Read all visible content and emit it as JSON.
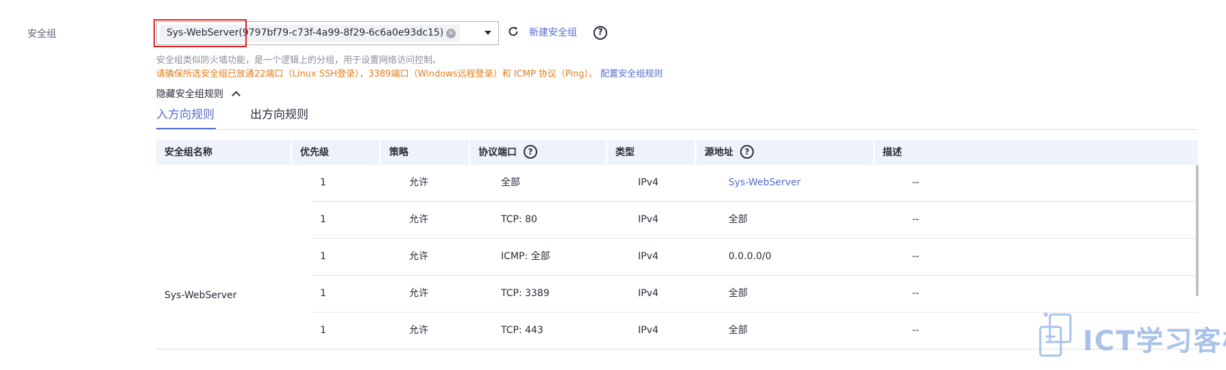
{
  "security_group": {
    "label": "安全组",
    "selected_value": "Sys-WebServer(9797bf79-c73f-4a99-8f29-6c6a0e93dc15)",
    "clear_glyph": "×",
    "new_link": "新建安全组",
    "help_glyph": "?",
    "hint": "安全组类似防火墙功能，是一个逻辑上的分组，用于设置网络访问控制。",
    "warning": "请确保所选安全组已放通22端口（Linux SSH登录），3389端口（Windows远程登录）和 ICMP 协议（Ping）。",
    "config_link": "配置安全组规则",
    "hide_rules": "隐藏安全组规则"
  },
  "tabs": [
    {
      "label": "入方向规则",
      "active": true
    },
    {
      "label": "出方向规则",
      "active": false
    }
  ],
  "table": {
    "columns": [
      "安全组名称",
      "优先级",
      "策略",
      "协议端口",
      "类型",
      "源地址",
      "描述"
    ],
    "group_name": "Sys-WebServer",
    "rows": [
      {
        "priority": "1",
        "policy": "允许",
        "port": "全部",
        "type": "IPv4",
        "source": "Sys-WebServer",
        "desc": "--"
      },
      {
        "priority": "1",
        "policy": "允许",
        "port": "TCP: 80",
        "type": "IPv4",
        "source": "全部",
        "desc": "--"
      },
      {
        "priority": "1",
        "policy": "允许",
        "port": "ICMP: 全部",
        "type": "IPv4",
        "source": "0.0.0.0/0",
        "desc": "--"
      },
      {
        "priority": "1",
        "policy": "允许",
        "port": "TCP: 3389",
        "type": "IPv4",
        "source": "全部",
        "desc": "--"
      },
      {
        "priority": "1",
        "policy": "允许",
        "port": "TCP: 443",
        "type": "IPv4",
        "source": "全部",
        "desc": "--"
      }
    ]
  },
  "watermark": {
    "text": "ICT学习客栈"
  },
  "colors": {
    "accent": "#526ecc",
    "warning": "#e37d1b",
    "highlight": "#e02020",
    "header_bg": "#eef2fb"
  },
  "icons": {
    "refresh": "refresh-icon",
    "help": "help-icon",
    "dropdown": "chevron-down-icon",
    "collapse": "chevron-up-icon",
    "clear": "clear-icon"
  }
}
